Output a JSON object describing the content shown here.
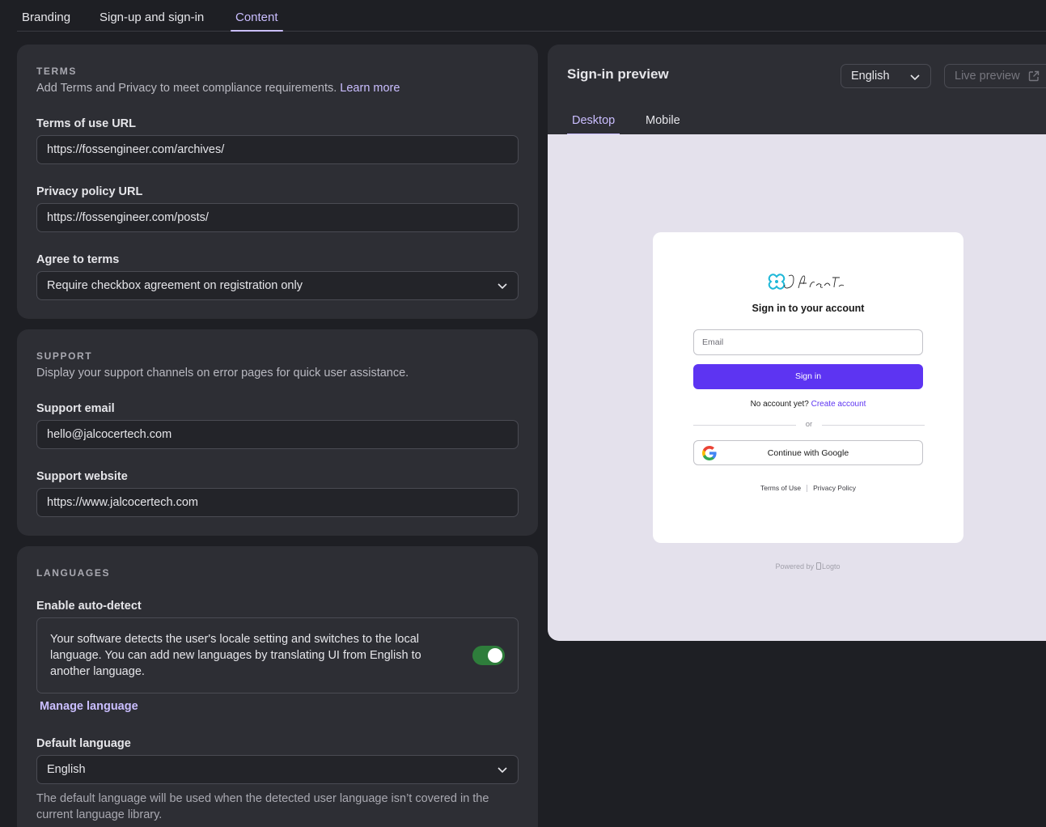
{
  "tabs": [
    {
      "label": "Branding"
    },
    {
      "label": "Sign-up and sign-in"
    },
    {
      "label": "Content"
    }
  ],
  "terms": {
    "title": "TERMS",
    "description": "Add Terms and Privacy to meet compliance requirements.",
    "learn_more": "Learn more",
    "terms_url_label": "Terms of use URL",
    "terms_url_value": "https://fossengineer.com/archives/",
    "privacy_url_label": "Privacy policy URL",
    "privacy_url_value": "https://fossengineer.com/posts/",
    "agree_label": "Agree to terms",
    "agree_value": "Require checkbox agreement on registration only"
  },
  "support": {
    "title": "SUPPORT",
    "description": "Display your support channels on error pages for quick user assistance.",
    "email_label": "Support email",
    "email_value": "hello@jalcocertech.com",
    "website_label": "Support website",
    "website_value": "https://www.jalcocertech.com"
  },
  "languages": {
    "title": "LANGUAGES",
    "autodetect_label": "Enable auto-detect",
    "autodetect_text": "Your software detects the user's locale setting and switches to the local language. You can add new languages by translating UI from English to another language.",
    "autodetect_enabled": true,
    "manage_link": "Manage language",
    "default_label": "Default language",
    "default_value": "English",
    "default_help": "The default language will be used when the detected user language isn’t covered in the current language library."
  },
  "preview": {
    "title": "Sign-in preview",
    "language": "English",
    "live_preview": "Live preview",
    "tabs": [
      {
        "label": "Desktop"
      },
      {
        "label": "Mobile"
      }
    ],
    "signin": {
      "title": "Sign in to your account",
      "email_placeholder": "Email",
      "button": "Sign in",
      "no_account": "No account yet?",
      "create_account": "Create account",
      "or": "or",
      "google": "Continue with Google",
      "terms": "Terms of Use",
      "privacy": "Privacy Policy"
    },
    "powered_by": "Powered by",
    "powered_brand": "Logto"
  },
  "colors": {
    "background": "#1e1f24",
    "card": "#2d2e34",
    "accent": "#cabeff",
    "primary_button": "#5d34f2",
    "toggle_on": "#2e7d3b",
    "preview_canvas": "#e4e1ec"
  }
}
